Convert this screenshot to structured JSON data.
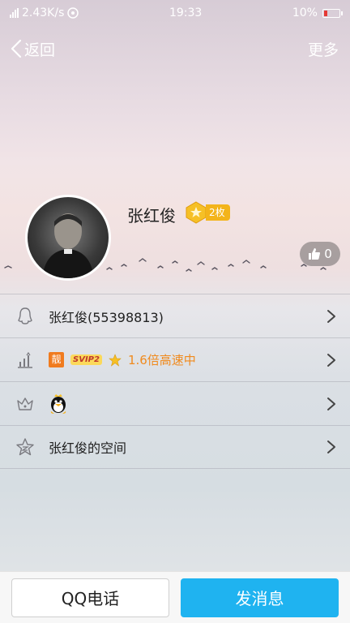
{
  "status": {
    "network_type": "4G",
    "speed": "2.43K/s",
    "time": "19:33",
    "battery": "10%",
    "battery_color": "#e53935"
  },
  "nav": {
    "back_label": "返回",
    "more_label": "更多"
  },
  "profile": {
    "name": "张红俊",
    "medal_count": "2枚",
    "likes": "0"
  },
  "rows": [
    {
      "icon": "qq-penguin-outline-icon",
      "text": "张红俊(55398813)"
    },
    {
      "icon": "level-chart-icon",
      "liang": "靓",
      "svip": "SVIP2",
      "speed": "1.6倍高速中"
    },
    {
      "icon": "crown-outline-icon",
      "mascot": "qq-penguin-mascot-icon"
    },
    {
      "icon": "qzone-star-icon",
      "text": "张红俊的空间"
    }
  ],
  "actions": {
    "call_label": "QQ电话",
    "message_label": "发消息",
    "accent_color": "#1fb3f0"
  }
}
